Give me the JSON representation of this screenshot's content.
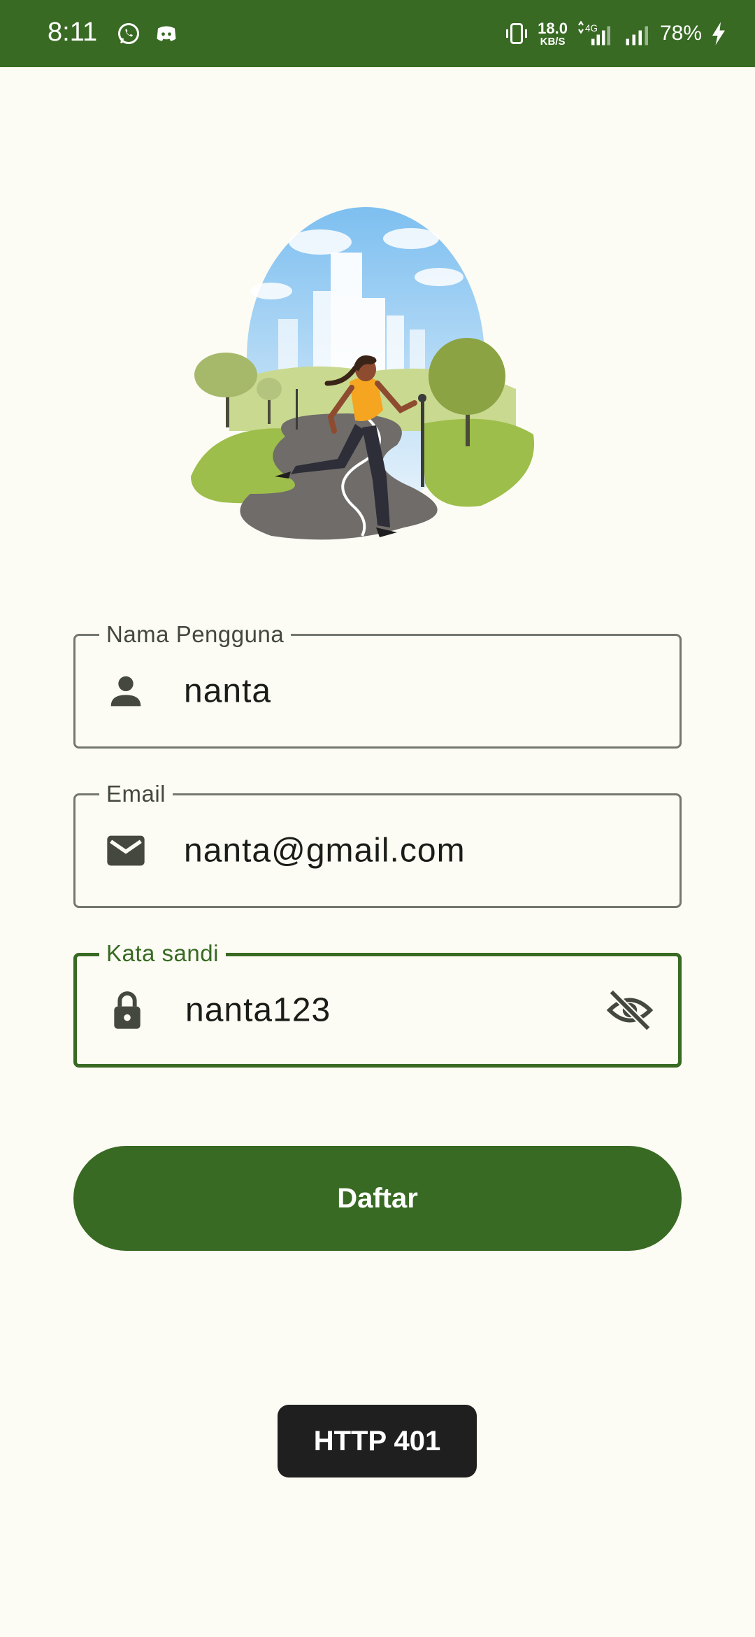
{
  "status_bar": {
    "time": "8:11",
    "net_speed_value": "18.0",
    "net_speed_unit": "KB/S",
    "network_type": "4G",
    "battery": "78%"
  },
  "form": {
    "username": {
      "label": "Nama Pengguna",
      "value": "nanta",
      "icon": "person-icon"
    },
    "email": {
      "label": "Email",
      "value": "nanta@gmail.com",
      "icon": "mail-icon"
    },
    "password": {
      "label": "Kata sandi",
      "value": "nanta123",
      "icon": "lock-icon",
      "toggle_icon": "visibility-off-icon"
    }
  },
  "submit_label": "Daftar",
  "toast": "HTTP 401",
  "colors": {
    "primary": "#386A23",
    "background": "#FCFCF4",
    "outline": "#74776D",
    "toast_bg": "#1F1F1F"
  }
}
